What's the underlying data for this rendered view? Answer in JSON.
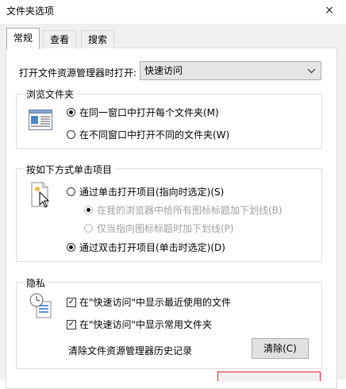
{
  "window": {
    "title": "文件夹选项",
    "close_glyph": "×"
  },
  "tabs": [
    {
      "label": "常规"
    },
    {
      "label": "查看"
    },
    {
      "label": "搜索"
    }
  ],
  "open_explorer": {
    "label": "打开文件资源管理器时打开:",
    "value": "快速访问"
  },
  "browse": {
    "title": "浏览文件夹",
    "options": [
      {
        "label": "在同一窗口中打开每个文件夹(M)"
      },
      {
        "label": "在不同窗口中打开不同的文件夹(W)"
      }
    ]
  },
  "click": {
    "title": "按如下方式单击项目",
    "single": "通过单击打开项目(指向时选定)(S)",
    "sub1": "在我的浏览器中给所有图标标题加下划线(B)",
    "sub2": "仅当指向图标标题时加下划线(P)",
    "double": "通过双击打开项目(单击时选定)(D)"
  },
  "privacy": {
    "title": "隐私",
    "recent_files": "在\"快速访问\"中显示最近使用的文件",
    "frequent_folders": "在\"快速访问\"中显示常用文件夹",
    "clear_label": "清除文件资源管理器历史记录",
    "clear_button": "清除(C)"
  }
}
